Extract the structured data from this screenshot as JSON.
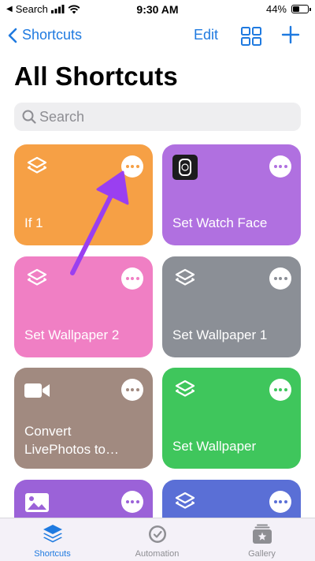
{
  "status_bar": {
    "carrier": "Search",
    "time": "9:30 AM",
    "battery": "44%",
    "battery_level": 0.44
  },
  "nav": {
    "back_label": "Shortcuts",
    "edit_label": "Edit"
  },
  "page_title": "All Shortcuts",
  "search": {
    "placeholder": "Search"
  },
  "shortcuts": [
    {
      "label": "If 1",
      "icon": "layers-icon",
      "color": "#f6a045"
    },
    {
      "label": "Set Watch Face",
      "icon": "watch-icon",
      "color": "#b070e0"
    },
    {
      "label": "Set Wallpaper 2",
      "icon": "layers-icon",
      "color": "#f07fc4"
    },
    {
      "label": "Set Wallpaper 1",
      "icon": "layers-icon",
      "color": "#8b8f96"
    },
    {
      "label": "Convert LivePhotos to…",
      "icon": "video-camera-icon",
      "color": "#a18a80"
    },
    {
      "label": "Set Wallpaper",
      "icon": "layers-icon",
      "color": "#3fc65c"
    },
    {
      "label": "",
      "icon": "photo-icon",
      "color": "#9b62d8"
    },
    {
      "label": "",
      "icon": "layers-icon",
      "color": "#5a6fd6"
    }
  ],
  "tabs": [
    {
      "label": "Shortcuts",
      "icon": "shortcuts-tab-icon",
      "active": true
    },
    {
      "label": "Automation",
      "icon": "automation-tab-icon",
      "active": false
    },
    {
      "label": "Gallery",
      "icon": "gallery-tab-icon",
      "active": false
    }
  ],
  "colors": {
    "accent": "#1f7ae0",
    "arrow": "#9a3ff0"
  }
}
